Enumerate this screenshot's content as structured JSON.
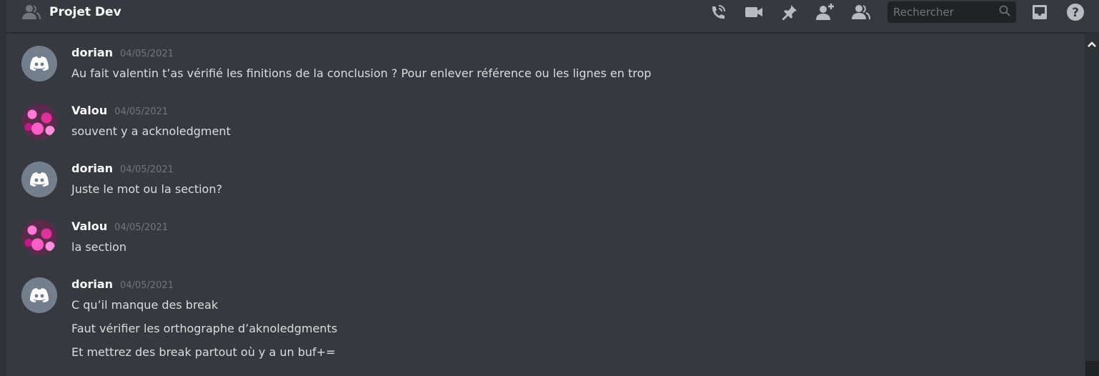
{
  "header": {
    "title": "Projet Dev",
    "search_placeholder": "Rechercher",
    "icons": [
      "start-voice-call-icon",
      "start-video-call-icon",
      "pinned-messages-icon",
      "add-friends-icon",
      "member-list-icon",
      "search-icon",
      "inbox-icon",
      "help-icon"
    ]
  },
  "messages": [
    {
      "author": "dorian",
      "avatar": "discord-default",
      "timestamp": "04/05/2021",
      "lines": [
        "Au fait valentin t’as vérifié les finitions de la conclusion ? Pour enlever référence ou les lignes en trop"
      ]
    },
    {
      "author": "Valou",
      "avatar": "flower-photo",
      "timestamp": "04/05/2021",
      "lines": [
        "souvent y a acknoledgment"
      ]
    },
    {
      "author": "dorian",
      "avatar": "discord-default",
      "timestamp": "04/05/2021",
      "lines": [
        "Juste le mot ou la section?"
      ]
    },
    {
      "author": "Valou",
      "avatar": "flower-photo",
      "timestamp": "04/05/2021",
      "lines": [
        "la section"
      ]
    },
    {
      "author": "dorian",
      "avatar": "discord-default",
      "timestamp": "04/05/2021",
      "lines": [
        "C qu’il manque des break",
        "Faut vérifier les orthographe d’aknoledgments",
        "Et mettrez des break partout où y a un buf+="
      ]
    }
  ],
  "colors": {
    "background": "#36393f",
    "text": "#dcddde",
    "muted": "#72767d",
    "icon": "#b9bbbe"
  }
}
